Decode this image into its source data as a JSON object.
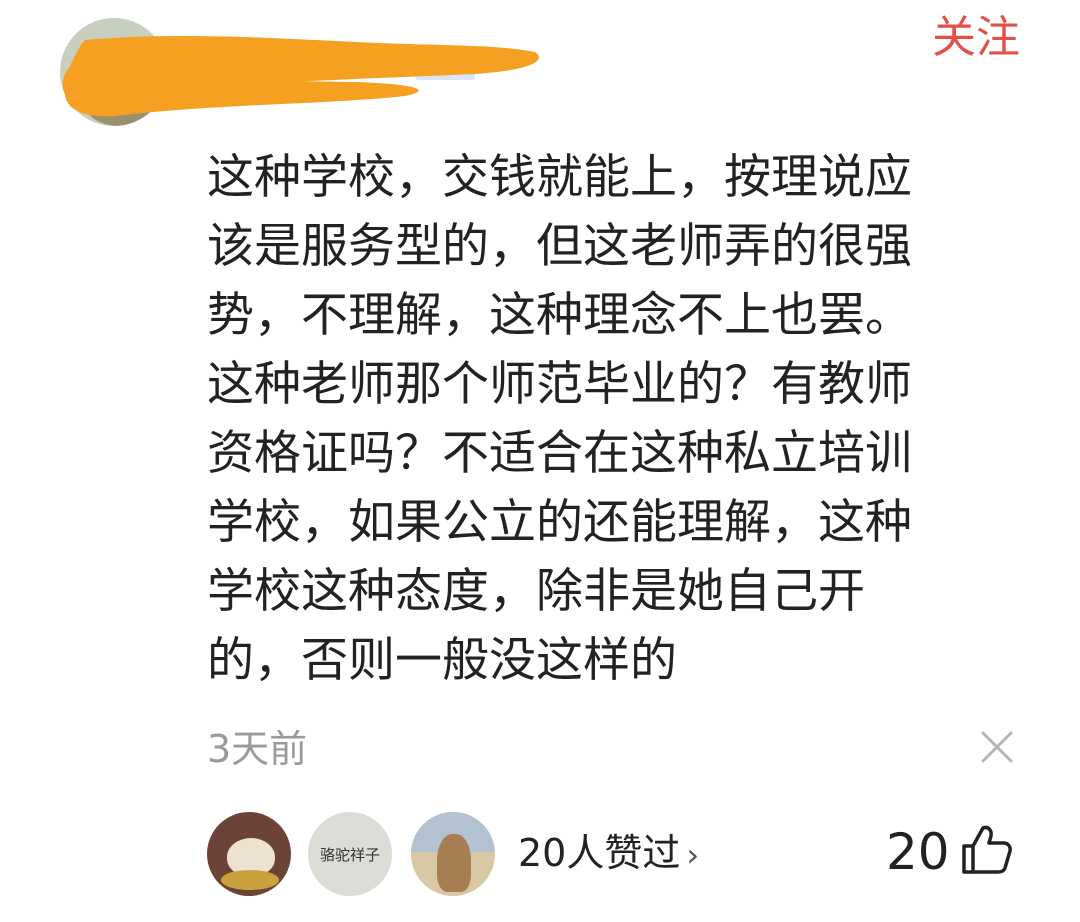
{
  "comment": {
    "follow_label": "关注",
    "text": "这种学校，交钱就能上，按理说应\n该是服务型的，但这老师弄的很强\n势，不理解，这种理念不上也罢。\n这种老师那个师范毕业的？有教师\n资格证吗？不适合在这种私立培训\n学校，如果公立的还能理解，这种\n学校这种态度，除非是她自己开\n的，否则一般没这样的",
    "timestamp": "3天前",
    "likers": [
      {
        "avatar_text": ""
      },
      {
        "avatar_text": "骆驼祥子"
      },
      {
        "avatar_text": ""
      }
    ],
    "likes_summary": "20人赞过",
    "likes_chevron": "›",
    "like_count": "20"
  },
  "colors": {
    "accent": "#e2504a",
    "redaction": "#f5a020",
    "text": "#222222",
    "muted": "#9a9a9a"
  },
  "icons": {
    "close": "close-icon",
    "like": "thumbs-up-icon",
    "chevron": "chevron-right-icon"
  }
}
